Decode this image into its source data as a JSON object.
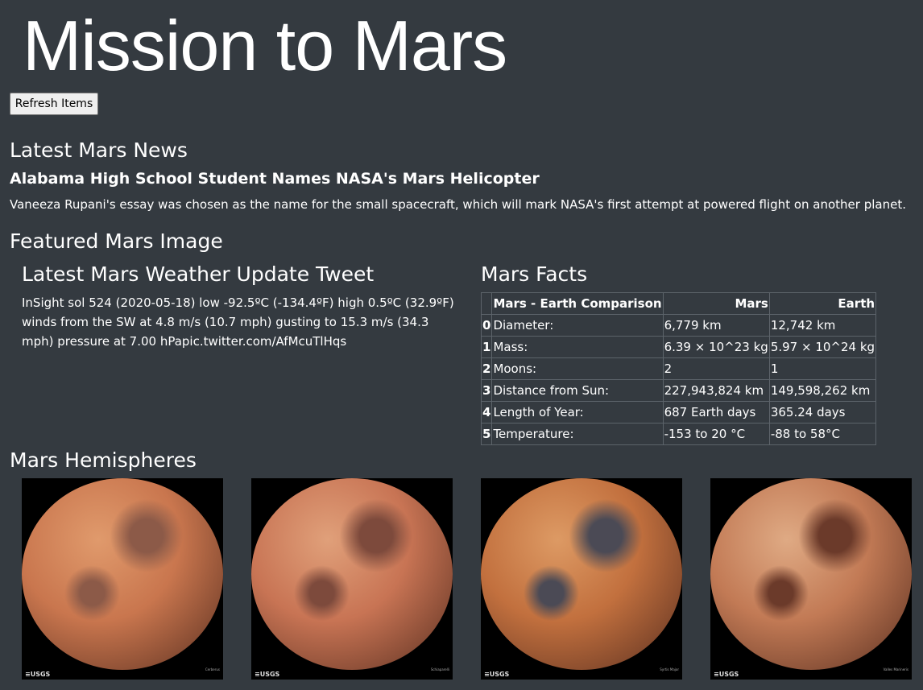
{
  "page_title": "Mission to Mars",
  "refresh_label": "Refresh Items",
  "news": {
    "heading": "Latest Mars News",
    "title": "Alabama High School Student Names NASA's Mars Helicopter",
    "paragraph": "Vaneeza Rupani's essay was chosen as the name for the small spacecraft, which will mark NASA's first attempt at powered flight on another planet."
  },
  "featured_image_heading": "Featured Mars Image",
  "weather": {
    "heading": "Latest Mars Weather Update Tweet",
    "text": "InSight sol 524 (2020-05-18) low -92.5ºC (-134.4ºF) high 0.5ºC (32.9ºF) winds from the SW at 4.8 m/s (10.7 mph) gusting to 15.3 m/s (34.3 mph) pressure at 7.00 hPapic.twitter.com/AfMcuTlHqs"
  },
  "facts": {
    "heading": "Mars Facts",
    "columns": [
      "",
      "Mars - Earth Comparison",
      "Mars",
      "Earth"
    ],
    "rows": [
      [
        "0",
        "Diameter:",
        "6,779 km",
        "12,742 km"
      ],
      [
        "1",
        "Mass:",
        "6.39 × 10^23 kg",
        "5.97 × 10^24 kg"
      ],
      [
        "2",
        "Moons:",
        "2",
        "1"
      ],
      [
        "3",
        "Distance from Sun:",
        "227,943,824 km",
        "149,598,262 km"
      ],
      [
        "4",
        "Length of Year:",
        "687 Earth days",
        "365.24 days"
      ],
      [
        "5",
        "Temperature:",
        "-153 to 20 °C",
        "-88 to 58°C"
      ]
    ]
  },
  "hemispheres": {
    "heading": "Mars Hemispheres",
    "logo_text": "≡USGS",
    "images": [
      {
        "caption": "Cerberus",
        "base": "#c9764e",
        "dark": "#8c5a48",
        "light": "#e09a6c"
      },
      {
        "caption": "Schiaparelli",
        "base": "#c87454",
        "dark": "#7d4a3c",
        "light": "#e0a07a"
      },
      {
        "caption": "Syrtis Major",
        "base": "#c2703e",
        "dark": "#4b4a55",
        "light": "#dd9a64"
      },
      {
        "caption": "Valles Marineris",
        "base": "#c27a55",
        "dark": "#6b3a2a",
        "light": "#dfaa84"
      }
    ]
  }
}
